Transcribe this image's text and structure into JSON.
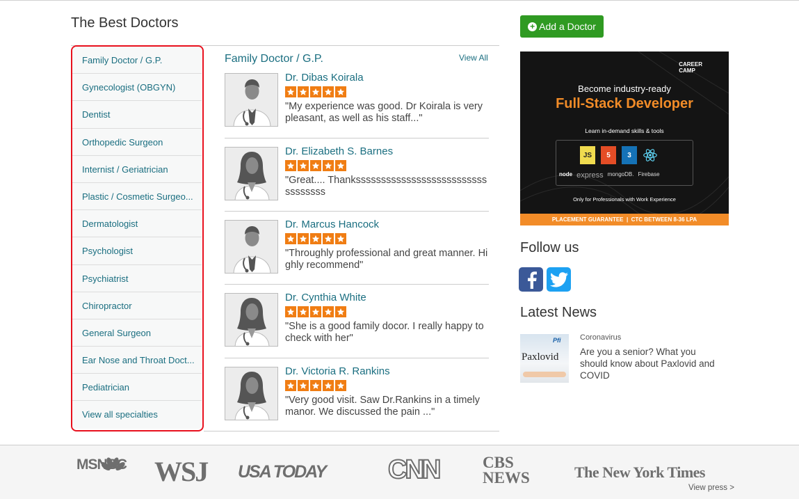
{
  "page_title": "The Best Doctors",
  "sidebar": {
    "items": [
      {
        "label": "Family Doctor / G.P."
      },
      {
        "label": "Gynecologist (OBGYN)"
      },
      {
        "label": "Dentist"
      },
      {
        "label": "Orthopedic Surgeon"
      },
      {
        "label": "Internist / Geriatrician"
      },
      {
        "label": "Plastic / Cosmetic Surgeo..."
      },
      {
        "label": "Dermatologist"
      },
      {
        "label": "Psychologist"
      },
      {
        "label": "Psychiatrist"
      },
      {
        "label": "Chiropractor"
      },
      {
        "label": "General Surgeon"
      },
      {
        "label": "Ear Nose and Throat Doct..."
      },
      {
        "label": "Pediatrician"
      },
      {
        "label": "View all specialties"
      }
    ]
  },
  "doctors_section": {
    "category": "Family Doctor / G.P.",
    "view_all": "View All",
    "doctors": [
      {
        "name": "Dr. Dibas Koirala",
        "rating": 5,
        "quote": "\"My experience was good. Dr Koirala is very pleasant, as well as his staff...\"",
        "gender": "male"
      },
      {
        "name": "Dr. Elizabeth S. Barnes",
        "rating": 5,
        "quote": "\"Great.... Thankssssssssssssssssssssssssssssssssss",
        "gender": "female"
      },
      {
        "name": "Dr. Marcus Hancock",
        "rating": 5,
        "quote": "\"Throughly professional and great manner. Highly recommend\"",
        "gender": "male"
      },
      {
        "name": "Dr. Cynthia White",
        "rating": 5,
        "quote": "\"She is a good family docor. I really happy to check with her\"",
        "gender": "female"
      },
      {
        "name": "Dr. Victoria R. Rankins",
        "rating": 5,
        "quote": "\"Very good visit. Saw Dr.Rankins in a timely manor. We discussed the pain ...\"",
        "gender": "female"
      }
    ]
  },
  "add_doctor": {
    "label": "Add a Doctor",
    "icon": "plus-circle-icon"
  },
  "ad": {
    "brand": "CAREER\nCAMP",
    "headline": "Become industry-ready",
    "title": "Full-Stack Developer",
    "subtitle": "Learn in-demand skills & tools",
    "tech_logos": [
      "JS",
      "5",
      "3"
    ],
    "stack": [
      "node",
      "express",
      "mongoDB.",
      "Firebase"
    ],
    "note": "Only for Professionals with Work Experience",
    "footer": "PLACEMENT GUARANTEE  |  CTC BETWEEN 8-36 LPA"
  },
  "follow": {
    "title": "Follow us",
    "icons": [
      "facebook-icon",
      "twitter-icon"
    ]
  },
  "news": {
    "title": "Latest News",
    "thumb_label": "Paxlovid",
    "category": "Coronavirus",
    "headline": "Are you a senior? What you should know about Paxlovid and COVID"
  },
  "press": {
    "logos": [
      "MSNBC",
      "WSJ",
      "USA TODAY",
      "CNN",
      "CBS NEWS",
      "The New York Times"
    ],
    "view_press": "View press >"
  },
  "colors": {
    "accent": "#1a6e80",
    "highlight": "#e8101d",
    "button": "#2f9a22",
    "star": "#f07d13"
  }
}
